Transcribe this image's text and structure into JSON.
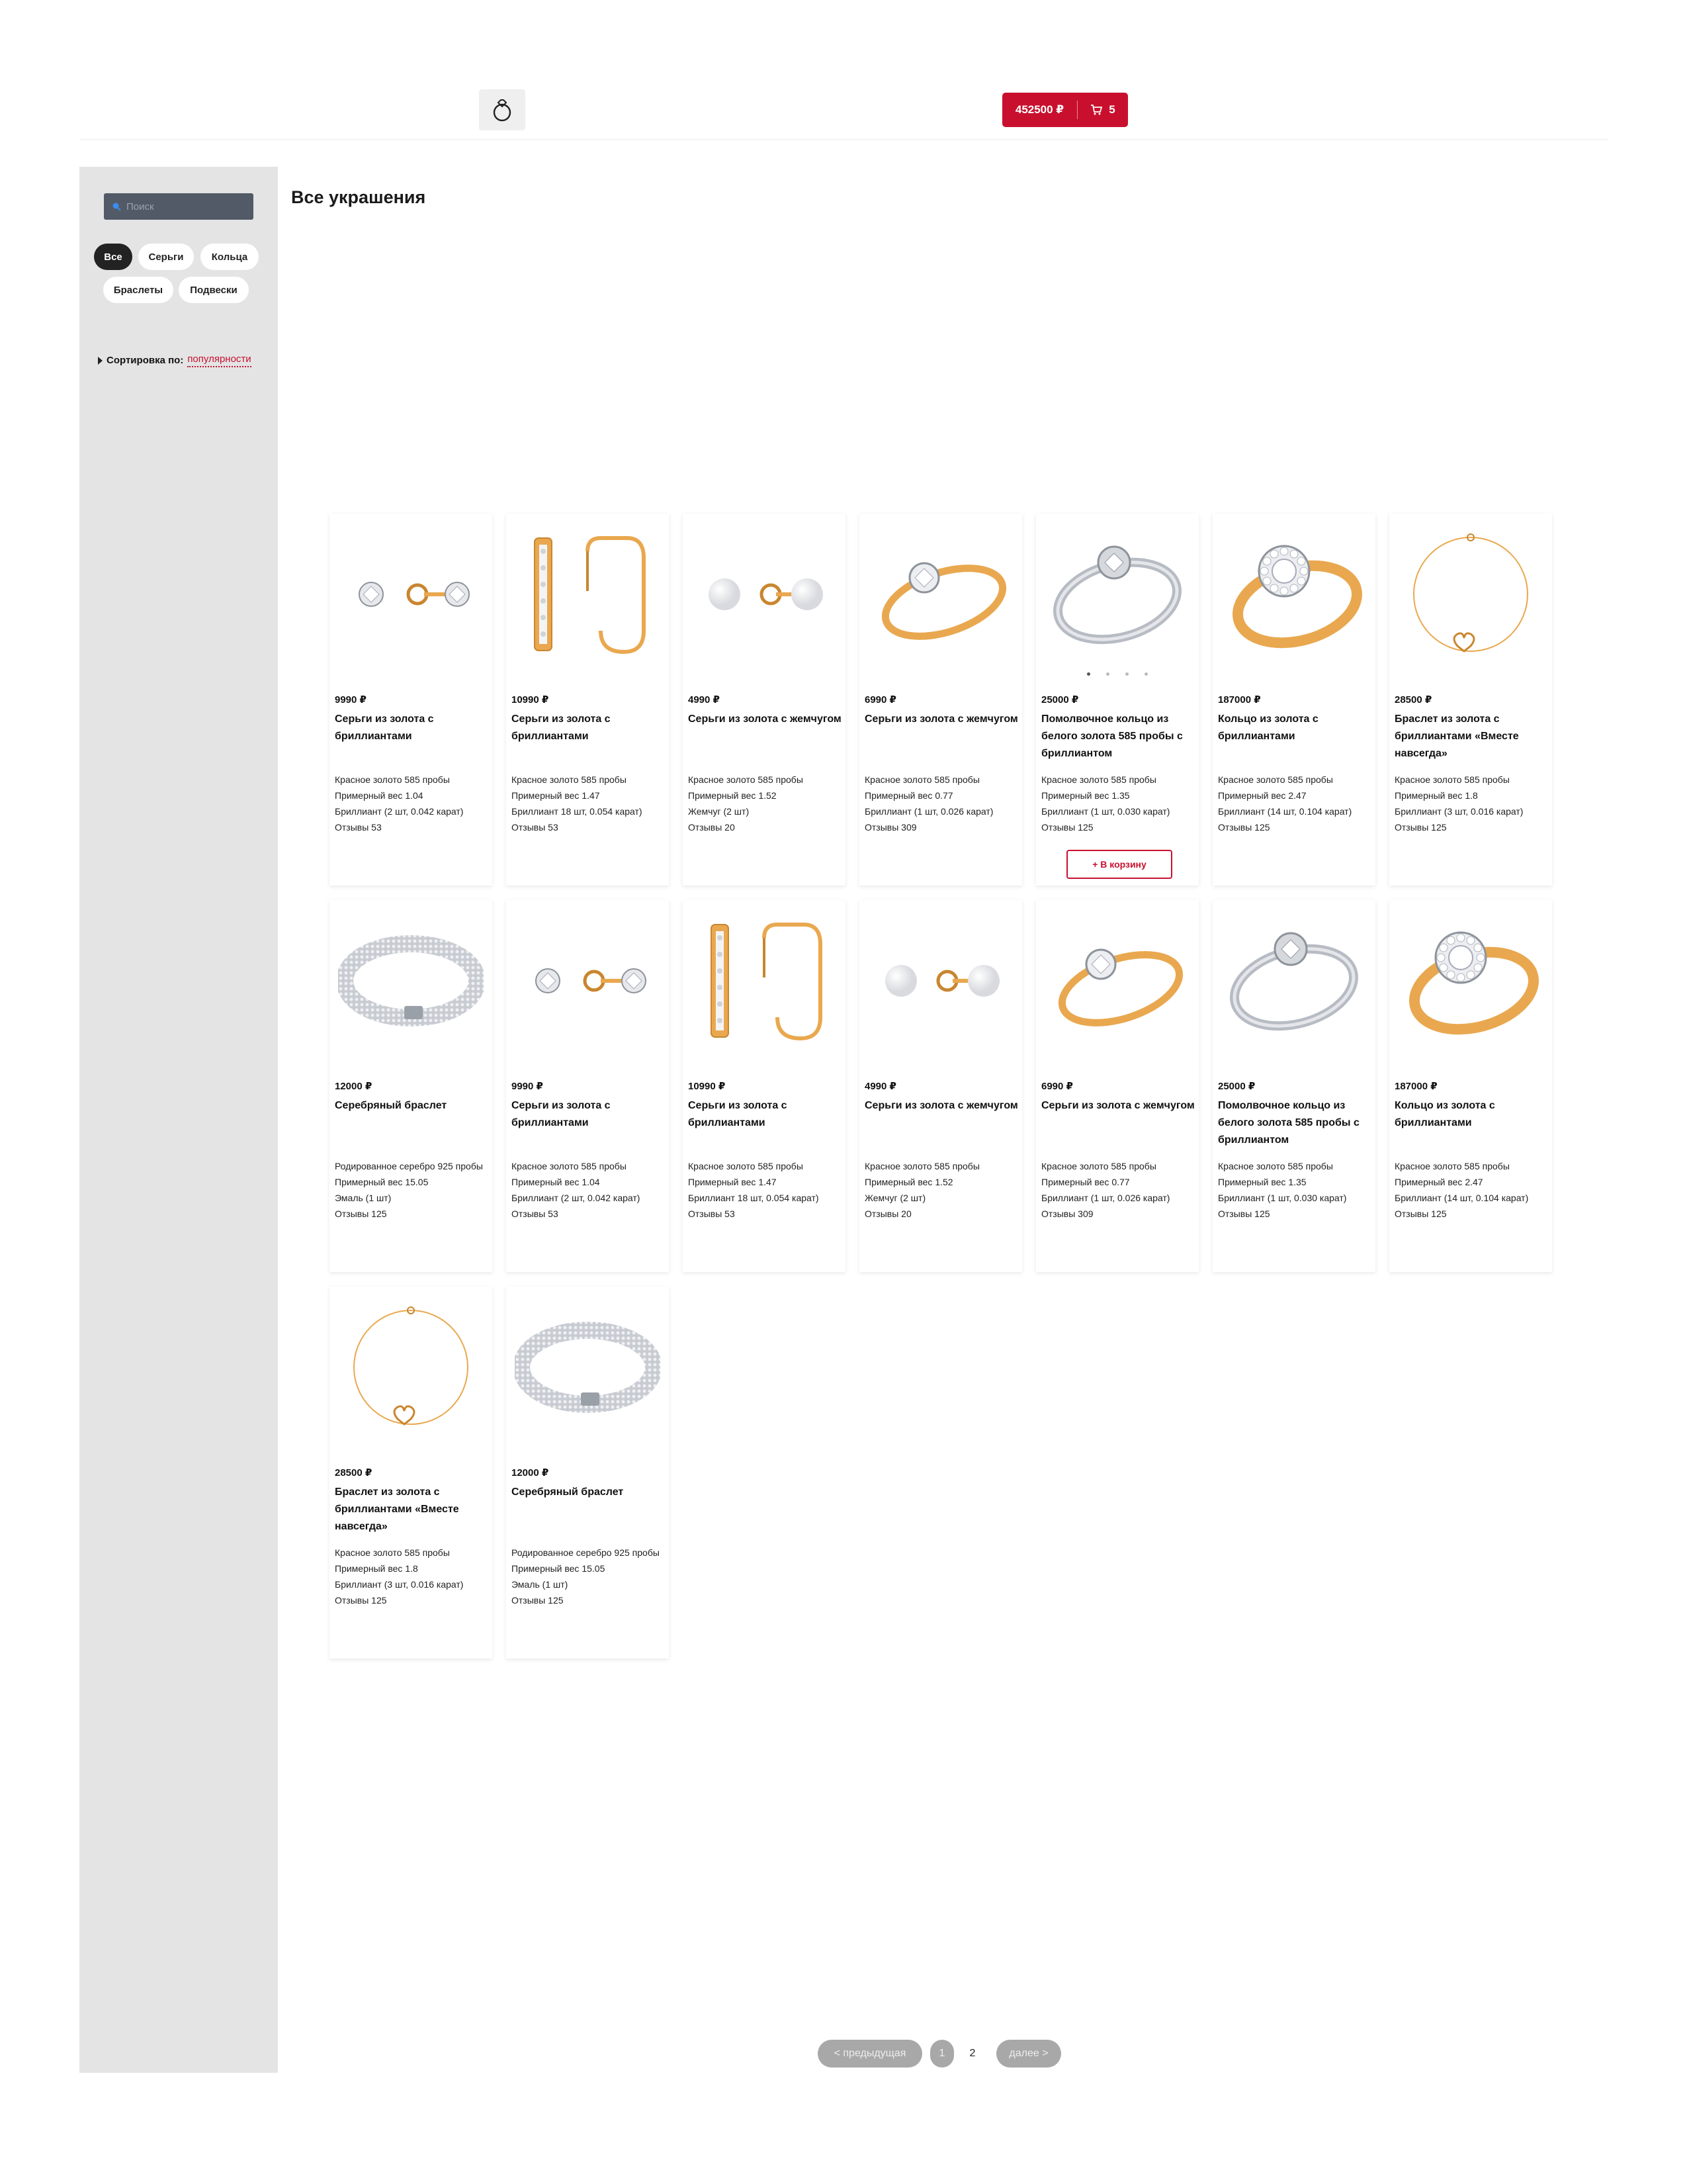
{
  "header": {
    "logo_alt": "ring-logo-icon",
    "cart": {
      "total": "452500 ₽",
      "count": "5"
    }
  },
  "sidebar": {
    "search_placeholder": "Поиск",
    "filters": [
      "Все",
      "Серьги",
      "Кольца",
      "Браслеты",
      "Подвески"
    ],
    "active_filter": "Все",
    "sort_label": "Сортировка по:",
    "sort_value": "популярности"
  },
  "page_title": "Все украшения",
  "products": [
    {
      "price": "9990 ₽",
      "name": "Серьги из золота с бриллиантами",
      "specs": [
        "Красное золото 585 пробы",
        "Примерный вес 1.04",
        "Бриллиант (2 шт, 0.042 карат)",
        "Отзывы 53"
      ],
      "type": "studs-diamond"
    },
    {
      "price": "10990 ₽",
      "name": "Серьги из золота с бриллиантами",
      "specs": [
        "Красное золото 585 пробы",
        "Примерный вес 1.47",
        "Бриллиант 18 шт, 0.054 карат)",
        "Отзывы 53"
      ],
      "type": "hoops"
    },
    {
      "price": "4990 ₽",
      "name": "Серьги из золота с жемчугом",
      "specs": [
        "Красное золото 585 пробы",
        "Примерный вес 1.52",
        "Жемчуг (2 шт)",
        "Отзывы 20"
      ],
      "type": "pearls"
    },
    {
      "price": "6990 ₽",
      "name": "Серьги из золота с жемчугом",
      "specs": [
        "Красное золото 585 пробы",
        "Примерный вес 0.77",
        "Бриллиант (1 шт, 0.026 карат)",
        "Отзывы 309"
      ],
      "type": "ring-gold-solitaire"
    },
    {
      "price": "25000 ₽",
      "name": "Помолвочное кольцо из белого золота 585 пробы с бриллиантом",
      "specs": [
        "Красное золото 585 пробы",
        "Примерный вес 1.35",
        "Бриллиант (1 шт, 0.030 карат)",
        "Отзывы 125"
      ],
      "type": "ring-white",
      "button": "+ В корзину"
    },
    {
      "price": "187000 ₽",
      "name": "Кольцо из золота с бриллиантами",
      "specs": [
        "Красное золото 585 пробы",
        "Примерный вес 2.47",
        "Бриллиант (14 шт, 0.104 карат)",
        "Отзывы 125"
      ],
      "type": "ring-halo"
    },
    {
      "price": "28500 ₽",
      "name": "Браслет из золота с бриллиантами «Вместе навсегда»",
      "specs": [
        "Красное золото 585 пробы",
        "Примерный вес 1.8",
        "Бриллиант (3 шт, 0.016 карат)",
        "Отзывы 125"
      ],
      "type": "chain-bracelet"
    },
    {
      "price": "12000 ₽",
      "name": "Серебряный браслет",
      "specs": [
        "Родированное серебро 925 пробы",
        "Примерный вес 15.05",
        "Эмаль (1 шт)",
        "Отзывы 125"
      ],
      "type": "silver-bracelet"
    },
    {
      "price": "9990 ₽",
      "name": "Серьги из золота с бриллиантами",
      "specs": [
        "Красное золото 585 пробы",
        "Примерный вес 1.04",
        "Бриллиант (2 шт, 0.042 карат)",
        "Отзывы 53"
      ],
      "type": "studs-diamond"
    },
    {
      "price": "10990 ₽",
      "name": "Серьги из золота с бриллиантами",
      "specs": [
        "Красное золото 585 пробы",
        "Примерный вес 1.47",
        "Бриллиант 18 шт, 0.054 карат)",
        "Отзывы 53"
      ],
      "type": "hoops"
    },
    {
      "price": "4990 ₽",
      "name": "Серьги из золота с жемчугом",
      "specs": [
        "Красное золото 585 пробы",
        "Примерный вес 1.52",
        "Жемчуг (2 шт)",
        "Отзывы 20"
      ],
      "type": "pearls"
    },
    {
      "price": "6990 ₽",
      "name": "Серьги из золота с жемчугом",
      "specs": [
        "Красное золото 585 пробы",
        "Примерный вес 0.77",
        "Бриллиант (1 шт, 0.026 карат)",
        "Отзывы 309"
      ],
      "type": "ring-gold-solitaire"
    },
    {
      "price": "25000 ₽",
      "name": "Помолвочное кольцо из белого золота 585 пробы с бриллиантом",
      "specs": [
        "Красное золото 585 пробы",
        "Примерный вес 1.35",
        "Бриллиант (1 шт, 0.030 карат)",
        "Отзывы 125"
      ],
      "type": "ring-white"
    },
    {
      "price": "187000 ₽",
      "name": "Кольцо из золота с бриллиантами",
      "specs": [
        "Красное золото 585 пробы",
        "Примерный вес 2.47",
        "Бриллиант (14 шт, 0.104 карат)",
        "Отзывы 125"
      ],
      "type": "ring-halo"
    },
    {
      "price": "28500 ₽",
      "name": "Браслет из золота с бриллиантами «Вместе навсегда»",
      "specs": [
        "Красное золото 585 пробы",
        "Примерный вес 1.8",
        "Бриллиант (3 шт, 0.016 карат)",
        "Отзывы 125"
      ],
      "type": "chain-bracelet"
    },
    {
      "price": "12000 ₽",
      "name": "Серебряный браслет",
      "specs": [
        "Родированное серебро 925 пробы",
        "Примерный вес 15.05",
        "Эмаль (1 шт)",
        "Отзывы 125"
      ],
      "type": "silver-bracelet"
    }
  ],
  "pagination": {
    "prev": "< предыдущая",
    "pages": [
      "1",
      "2"
    ],
    "current": "2",
    "next": "далее >"
  },
  "colors": {
    "accent": "#c8102e",
    "sidebar": "#e4e4e5",
    "gold": "#e9a84f",
    "silver": "#b7bcc4"
  }
}
